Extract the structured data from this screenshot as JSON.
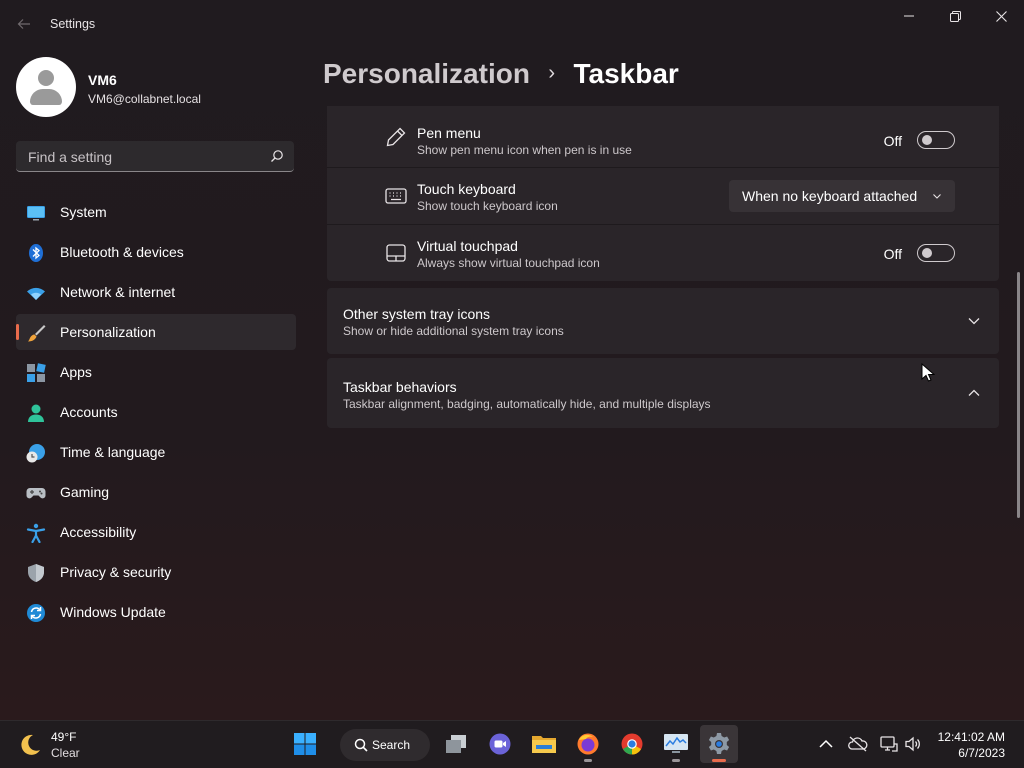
{
  "window": {
    "app_title": "Settings",
    "back_icon": "arrow-left-icon",
    "controls": [
      "minimize-icon",
      "maximize-icon",
      "close-icon"
    ]
  },
  "profile": {
    "name": "VM6",
    "email": "VM6@collabnet.local"
  },
  "search": {
    "placeholder": "Find a setting"
  },
  "sidebar": {
    "items": [
      {
        "label": "System",
        "icon": "monitor-icon"
      },
      {
        "label": "Bluetooth & devices",
        "icon": "bluetooth-icon"
      },
      {
        "label": "Network & internet",
        "icon": "wifi-icon"
      },
      {
        "label": "Personalization",
        "icon": "brush-icon",
        "active": true
      },
      {
        "label": "Apps",
        "icon": "apps-icon"
      },
      {
        "label": "Accounts",
        "icon": "person-icon"
      },
      {
        "label": "Time & language",
        "icon": "globe-clock-icon"
      },
      {
        "label": "Gaming",
        "icon": "gamepad-icon"
      },
      {
        "label": "Accessibility",
        "icon": "accessibility-icon"
      },
      {
        "label": "Privacy & security",
        "icon": "shield-icon"
      },
      {
        "label": "Windows Update",
        "icon": "update-icon"
      }
    ]
  },
  "breadcrumb": {
    "parent": "Personalization",
    "separator": "›",
    "current": "Taskbar"
  },
  "pen_menu": {
    "title": "Pen menu",
    "description": "Show pen menu icon when pen is in use",
    "state_label": "Off",
    "on": false
  },
  "touch_keyboard": {
    "title": "Touch keyboard",
    "description": "Show touch keyboard icon",
    "selected": "When no keyboard attached"
  },
  "virtual_touchpad": {
    "title": "Virtual touchpad",
    "description": "Always show virtual touchpad icon",
    "state_label": "Off",
    "on": false
  },
  "other_tray_icons": {
    "title": "Other system tray icons",
    "description": "Show or hide additional system tray icons",
    "expanded": false
  },
  "taskbar_behaviors": {
    "title": "Taskbar behaviors",
    "description": "Taskbar alignment, badging, automatically hide, and multiple displays",
    "expanded": true
  },
  "taskbar": {
    "weather_temp": "49°F",
    "weather_condition": "Clear",
    "search_label": "Search",
    "apps": [
      "start-icon",
      "task-view-icon",
      "teams-chat-icon",
      "file-explorer-icon",
      "firefox-icon",
      "chrome-icon",
      "resource-monitor-icon",
      "settings-icon"
    ],
    "tray_icons": [
      "chevron-up-icon",
      "onedrive-offline-icon",
      "network-icon",
      "volume-icon"
    ],
    "time": "12:41:02 AM",
    "date": "6/7/2023"
  },
  "colors": {
    "accent": "#e96b4c",
    "background": "#201b1f",
    "card": "#2a2529"
  }
}
